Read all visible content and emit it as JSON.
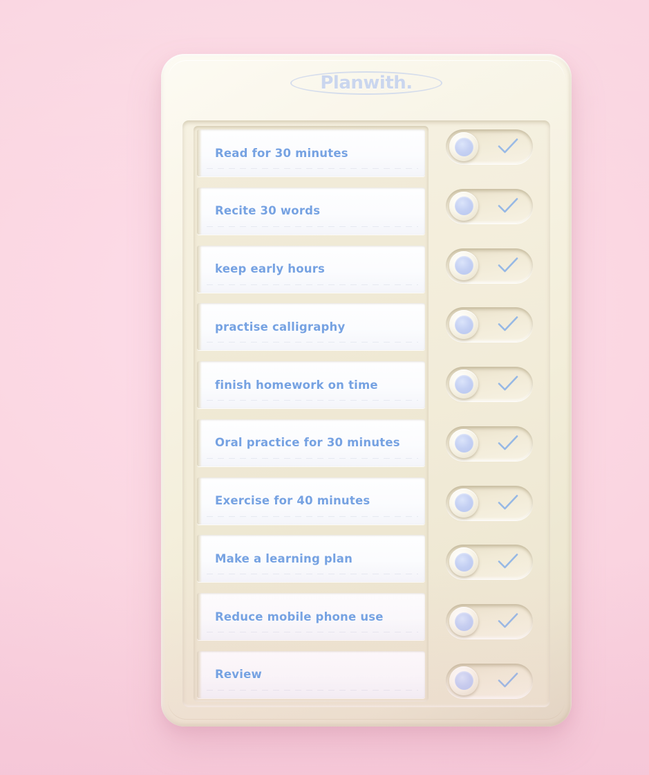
{
  "theme": {
    "background_pink": "#fbd8e3",
    "device_cream": "#f6f1e1",
    "text_blue": "#76a2e2",
    "knob_periwinkle": "#c4d0f3",
    "check_blue": "#8fb4e6"
  },
  "device": {
    "brand": "Planwith.",
    "brand_icon": "oval-outline"
  },
  "checklist": {
    "items": [
      {
        "label": "Read for 30 minutes",
        "switch_state": "left",
        "check_icon": "check-icon"
      },
      {
        "label": "Recite 30 words",
        "switch_state": "left",
        "check_icon": "check-icon"
      },
      {
        "label": "keep early hours",
        "switch_state": "left",
        "check_icon": "check-icon"
      },
      {
        "label": "practise calligraphy",
        "switch_state": "left",
        "check_icon": "check-icon"
      },
      {
        "label": "finish homework on time",
        "switch_state": "left",
        "check_icon": "check-icon"
      },
      {
        "label": "Oral practice for 30 minutes",
        "switch_state": "left",
        "check_icon": "check-icon"
      },
      {
        "label": "Exercise for 40 minutes",
        "switch_state": "left",
        "check_icon": "check-icon"
      },
      {
        "label": "Make a learning plan",
        "switch_state": "left",
        "check_icon": "check-icon"
      },
      {
        "label": "Reduce mobile phone use",
        "switch_state": "left",
        "check_icon": "check-icon"
      },
      {
        "label": "Review",
        "switch_state": "left",
        "check_icon": "check-icon"
      }
    ]
  }
}
